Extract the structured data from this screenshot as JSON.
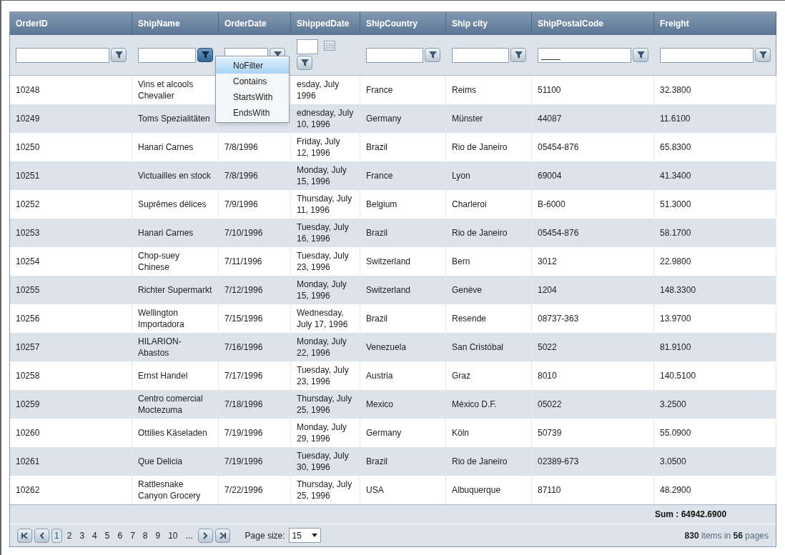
{
  "grid": {
    "columns": [
      {
        "label": "OrderID",
        "filter": {
          "kind": "text"
        }
      },
      {
        "label": "ShipName",
        "filter": {
          "kind": "text",
          "menu_open": true
        }
      },
      {
        "label": "OrderDate",
        "filter": {
          "kind": "text"
        }
      },
      {
        "label": "ShippedDate",
        "filter": {
          "kind": "date"
        }
      },
      {
        "label": "ShipCountry",
        "filter": {
          "kind": "text"
        }
      },
      {
        "label": "Ship city",
        "filter": {
          "kind": "text"
        }
      },
      {
        "label": "ShipPostalCode",
        "filter": {
          "kind": "text",
          "value": "____"
        }
      },
      {
        "label": "Freight",
        "filter": {
          "kind": "text"
        }
      }
    ],
    "filter_menu": [
      {
        "label": "NoFilter",
        "selected": true
      },
      {
        "label": "Contains",
        "selected": false
      },
      {
        "label": "StartsWith",
        "selected": false
      },
      {
        "label": "EndsWith",
        "selected": false
      }
    ],
    "rows": [
      [
        "10248",
        "Vins et alcools Chevalier",
        null,
        "esday, July 1996",
        "France",
        "Reims",
        "51100",
        "32.3800"
      ],
      [
        "10249",
        "Toms Spezialitäten",
        null,
        "ednesday, July 10, 1996",
        "Germany",
        "Münster",
        "44087",
        "11.6100"
      ],
      [
        "10250",
        "Hanari Carnes",
        "7/8/1996",
        "Friday, July 12, 1996",
        "Brazil",
        "Rio de Janeiro",
        "05454-876",
        "65.8300"
      ],
      [
        "10251",
        "Victuailles en stock",
        "7/8/1996",
        "Monday, July 15, 1996",
        "France",
        "Lyon",
        "69004",
        "41.3400"
      ],
      [
        "10252",
        "Suprêmes délices",
        "7/9/1996",
        "Thursday, July 11, 1996",
        "Belgium",
        "Charleroi",
        "B-6000",
        "51.3000"
      ],
      [
        "10253",
        "Hanari Carnes",
        "7/10/1996",
        "Tuesday, July 16, 1996",
        "Brazil",
        "Rio de Janeiro",
        "05454-876",
        "58.1700"
      ],
      [
        "10254",
        "Chop-suey Chinese",
        "7/11/1996",
        "Tuesday, July 23, 1996",
        "Switzerland",
        "Bern",
        "3012",
        "22.9800"
      ],
      [
        "10255",
        "Richter Supermarkt",
        "7/12/1996",
        "Monday, July 15, 1996",
        "Switzerland",
        "Genève",
        "1204",
        "148.3300"
      ],
      [
        "10256",
        "Wellington Importadora",
        "7/15/1996",
        "Wednesday, July 17, 1996",
        "Brazil",
        "Resende",
        "08737-363",
        "13.9700"
      ],
      [
        "10257",
        "HILARION-Abastos",
        "7/16/1996",
        "Monday, July 22, 1996",
        "Venezuela",
        "San Cristóbal",
        "5022",
        "81.9100"
      ],
      [
        "10258",
        "Ernst Handel",
        "7/17/1996",
        "Tuesday, July 23, 1996",
        "Austria",
        "Graz",
        "8010",
        "140.5100"
      ],
      [
        "10259",
        "Centro comercial Moctezuma",
        "7/18/1996",
        "Thursday, July 25, 1996",
        "Mexico",
        "México D.F.",
        "05022",
        "3.2500"
      ],
      [
        "10260",
        "Ottilies Käseladen",
        "7/19/1996",
        "Monday, July 29, 1996",
        "Germany",
        "Köln",
        "50739",
        "55.0900"
      ],
      [
        "10261",
        "Que Delicia",
        "7/19/1996",
        "Tuesday, July 30, 1996",
        "Brazil",
        "Rio de Janeiro",
        "02389-673",
        "3.0500"
      ],
      [
        "10262",
        "Rattlesnake Canyon Grocery",
        "7/22/1996",
        "Thursday, July 25, 1996",
        "USA",
        "Albuquerque",
        "87110",
        "48.2900"
      ]
    ],
    "footer_sum": "Sum : 64942.6900",
    "pager": {
      "pages": [
        {
          "label": "1",
          "selected": true
        },
        {
          "label": "2",
          "selected": false
        },
        {
          "label": "3",
          "selected": false
        },
        {
          "label": "4",
          "selected": false
        },
        {
          "label": "5",
          "selected": false
        },
        {
          "label": "6",
          "selected": false
        },
        {
          "label": "7",
          "selected": false
        },
        {
          "label": "8",
          "selected": false
        },
        {
          "label": "9",
          "selected": false
        },
        {
          "label": "10",
          "selected": false
        },
        {
          "label": "...",
          "selected": false
        }
      ],
      "page_size_label": "Page size:",
      "page_size": "15",
      "info": "**830** items in **56** pages"
    }
  }
}
